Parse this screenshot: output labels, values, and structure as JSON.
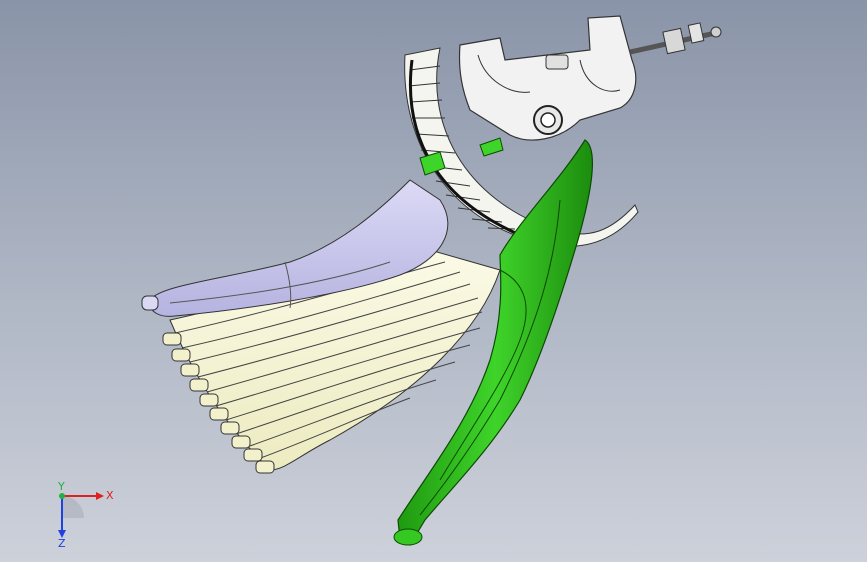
{
  "viewport": {
    "background_top": "#8a94a8",
    "background_bottom": "#cdd1da"
  },
  "model": {
    "parts": [
      {
        "name": "lever-grip",
        "color": "#2fbf1a"
      },
      {
        "name": "ratchet-segment",
        "color": "#f5f5f0"
      },
      {
        "name": "mounting-bracket",
        "color": "#f2f2f2"
      },
      {
        "name": "adjuster-bolt",
        "color": "#d8d8d8"
      },
      {
        "name": "boot-cover",
        "color": "#c9c8ea"
      },
      {
        "name": "bellows",
        "color": "#f6f4d2"
      }
    ]
  },
  "triad": {
    "x_label": "X",
    "y_label": "Y",
    "z_label": "Z",
    "x_color": "#e02020",
    "y_color": "#22b040",
    "z_color": "#2040e0"
  }
}
